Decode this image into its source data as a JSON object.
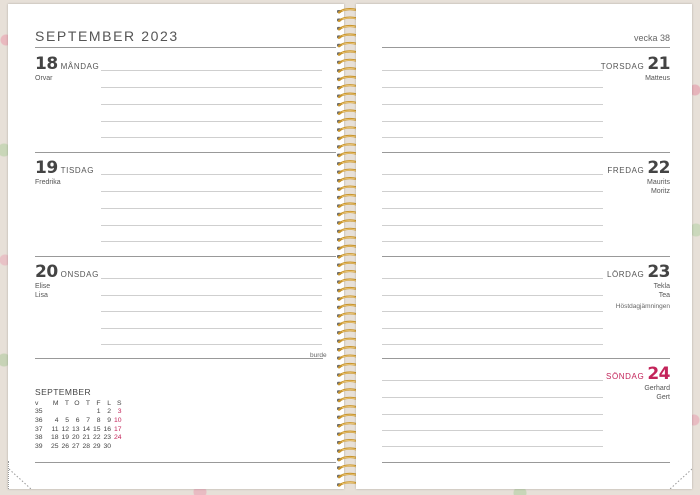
{
  "left_page": {
    "month_title": "SEPTEMBER 2023",
    "days": [
      {
        "num": "18",
        "name": "MÅNDAG",
        "namedays": [
          "Orvar"
        ],
        "red": false
      },
      {
        "num": "19",
        "name": "TISDAG",
        "namedays": [
          "Fredrika"
        ],
        "red": false
      },
      {
        "num": "20",
        "name": "ONSDAG",
        "namedays": [
          "Elise",
          "Lisa"
        ],
        "red": false
      }
    ],
    "footer_note": "burde"
  },
  "right_page": {
    "week_label": "vecka 38",
    "days": [
      {
        "num": "21",
        "name": "TORSDAG",
        "namedays": [
          "Matteus"
        ],
        "red": false,
        "note": ""
      },
      {
        "num": "22",
        "name": "FREDAG",
        "namedays": [
          "Maurits",
          "Moritz"
        ],
        "red": false,
        "note": ""
      },
      {
        "num": "23",
        "name": "LÖRDAG",
        "namedays": [
          "Tekla",
          "Tea"
        ],
        "red": false,
        "note": "Höstdagjämningen"
      },
      {
        "num": "24",
        "name": "SÖNDAG",
        "namedays": [
          "Gerhard",
          "Gert"
        ],
        "red": true,
        "note": ""
      }
    ]
  },
  "mini_calendar": {
    "title": "SEPTEMBER",
    "headers": [
      "v",
      "M",
      "T",
      "O",
      "T",
      "F",
      "L",
      "S"
    ],
    "rows": [
      [
        "35",
        "",
        "",
        "",
        "",
        "1",
        "2",
        "3"
      ],
      [
        "36",
        "4",
        "5",
        "6",
        "7",
        "8",
        "9",
        "10"
      ],
      [
        "37",
        "11",
        "12",
        "13",
        "14",
        "15",
        "16",
        "17"
      ],
      [
        "38",
        "18",
        "19",
        "20",
        "21",
        "22",
        "23",
        "24"
      ],
      [
        "39",
        "25",
        "26",
        "27",
        "28",
        "29",
        "30",
        ""
      ]
    ],
    "sunday_color": "#c3245a"
  },
  "colors": {
    "accent_red": "#c3245a",
    "spiral_gold": "#c9952c"
  }
}
